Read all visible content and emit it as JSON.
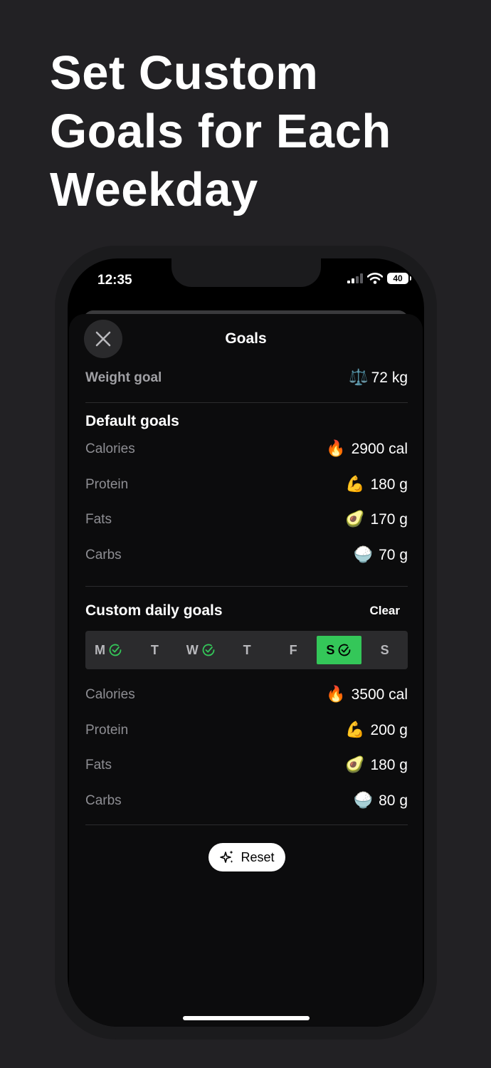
{
  "headline": [
    "Set Custom",
    "Goals for Each",
    "Weekday"
  ],
  "status": {
    "time": "12:35",
    "battery": "40"
  },
  "sheet": {
    "title": "Goals"
  },
  "weight_goal": {
    "label": "Weight goal",
    "icon": "⚖️",
    "value": "72 kg"
  },
  "default_goals": {
    "title": "Default goals",
    "rows": [
      {
        "label": "Calories",
        "icon": "🔥",
        "value": "2900 cal"
      },
      {
        "label": "Protein",
        "icon": "💪",
        "value": "180 g"
      },
      {
        "label": "Fats",
        "icon": "🥑",
        "value": "170 g"
      },
      {
        "label": "Carbs",
        "icon": "🍚",
        "value": "70 g"
      }
    ]
  },
  "custom_goals": {
    "title": "Custom daily goals",
    "clear_label": "Clear",
    "days": [
      {
        "label": "M",
        "checked": true,
        "selected": false
      },
      {
        "label": "T",
        "checked": false,
        "selected": false
      },
      {
        "label": "W",
        "checked": true,
        "selected": false
      },
      {
        "label": "T",
        "checked": false,
        "selected": false
      },
      {
        "label": "F",
        "checked": false,
        "selected": false
      },
      {
        "label": "S",
        "checked": true,
        "selected": true
      },
      {
        "label": "S",
        "checked": false,
        "selected": false
      }
    ],
    "rows": [
      {
        "label": "Calories",
        "icon": "🔥",
        "value": "3500 cal"
      },
      {
        "label": "Protein",
        "icon": "💪",
        "value": "200 g"
      },
      {
        "label": "Fats",
        "icon": "🥑",
        "value": "180 g"
      },
      {
        "label": "Carbs",
        "icon": "🍚",
        "value": "80 g"
      }
    ]
  },
  "reset_label": "Reset",
  "colors": {
    "background": "#222124",
    "accent_green": "#34c759",
    "muted_text": "#8e8e93"
  }
}
